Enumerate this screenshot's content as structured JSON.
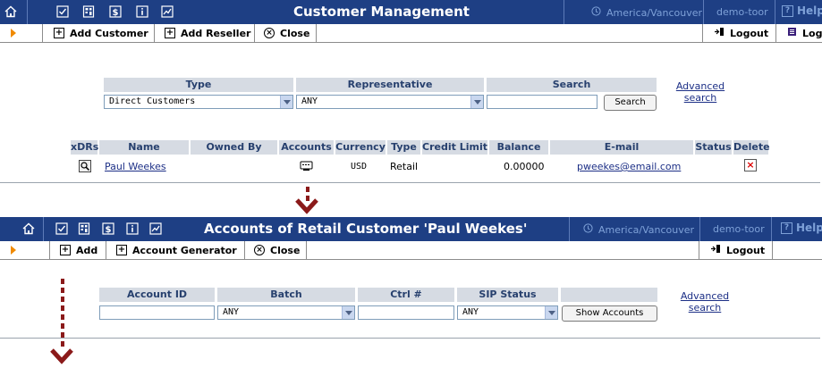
{
  "top": {
    "title": "Customer Management",
    "timezone": "America/Vancouver",
    "user": "demo-toor",
    "help_label": "Help",
    "toolbar": {
      "add_customer": "Add Customer",
      "add_reseller": "Add Reseller",
      "close": "Close",
      "logout": "Logout",
      "log_partial": "Log"
    },
    "filter": {
      "type_label": "Type",
      "type_value": "Direct Customers",
      "rep_label": "Representative",
      "rep_value": "ANY",
      "search_label": "Search",
      "search_value": "",
      "search_button": "Search",
      "adv_line1": "Advanced",
      "adv_line2": "search"
    },
    "table": {
      "headers": [
        "xDRs",
        "Name",
        "Owned By",
        "Accounts",
        "Currency",
        "Type",
        "Credit Limit",
        "Balance",
        "E-mail",
        "Status",
        "Delete"
      ],
      "row": {
        "name": "Paul Weekes",
        "owned_by": "",
        "currency": "USD",
        "type": "Retail",
        "credit_limit": "",
        "balance": "0.00000",
        "email": "pweekes@email.com",
        "status": ""
      }
    }
  },
  "bottom": {
    "title": "Accounts of Retail Customer 'Paul Weekes'",
    "timezone": "America/Vancouver",
    "user": "demo-toor",
    "help_label": "Help",
    "toolbar": {
      "add": "Add",
      "account_generator": "Account Generator",
      "close": "Close",
      "logout": "Logout"
    },
    "filter": {
      "account_id_label": "Account ID",
      "account_id_value": "",
      "batch_label": "Batch",
      "batch_value": "ANY",
      "ctrl_label": "Ctrl #",
      "ctrl_value": "",
      "sip_label": "SIP Status",
      "sip_value": "ANY",
      "show_button": "Show Accounts",
      "adv_line1": "Advanced",
      "adv_line2": "search"
    }
  },
  "colors": {
    "titlebar": "#1e3f84",
    "toolbar_arrow": "#f08a00",
    "flow_arrow": "#8b1a1a",
    "header_bg": "#d6dbe3",
    "link": "#1c2f86"
  },
  "icons": [
    "home-icon",
    "checkbox-icon",
    "calculator-icon",
    "dollar-icon",
    "info-icon",
    "chart-icon",
    "globe-icon",
    "help-icon",
    "plus-box-icon",
    "close-circle-icon",
    "logout-icon",
    "log-icon",
    "magnifier-icon",
    "accounts-icon",
    "delete-x-icon",
    "arrow-down-icon"
  ]
}
